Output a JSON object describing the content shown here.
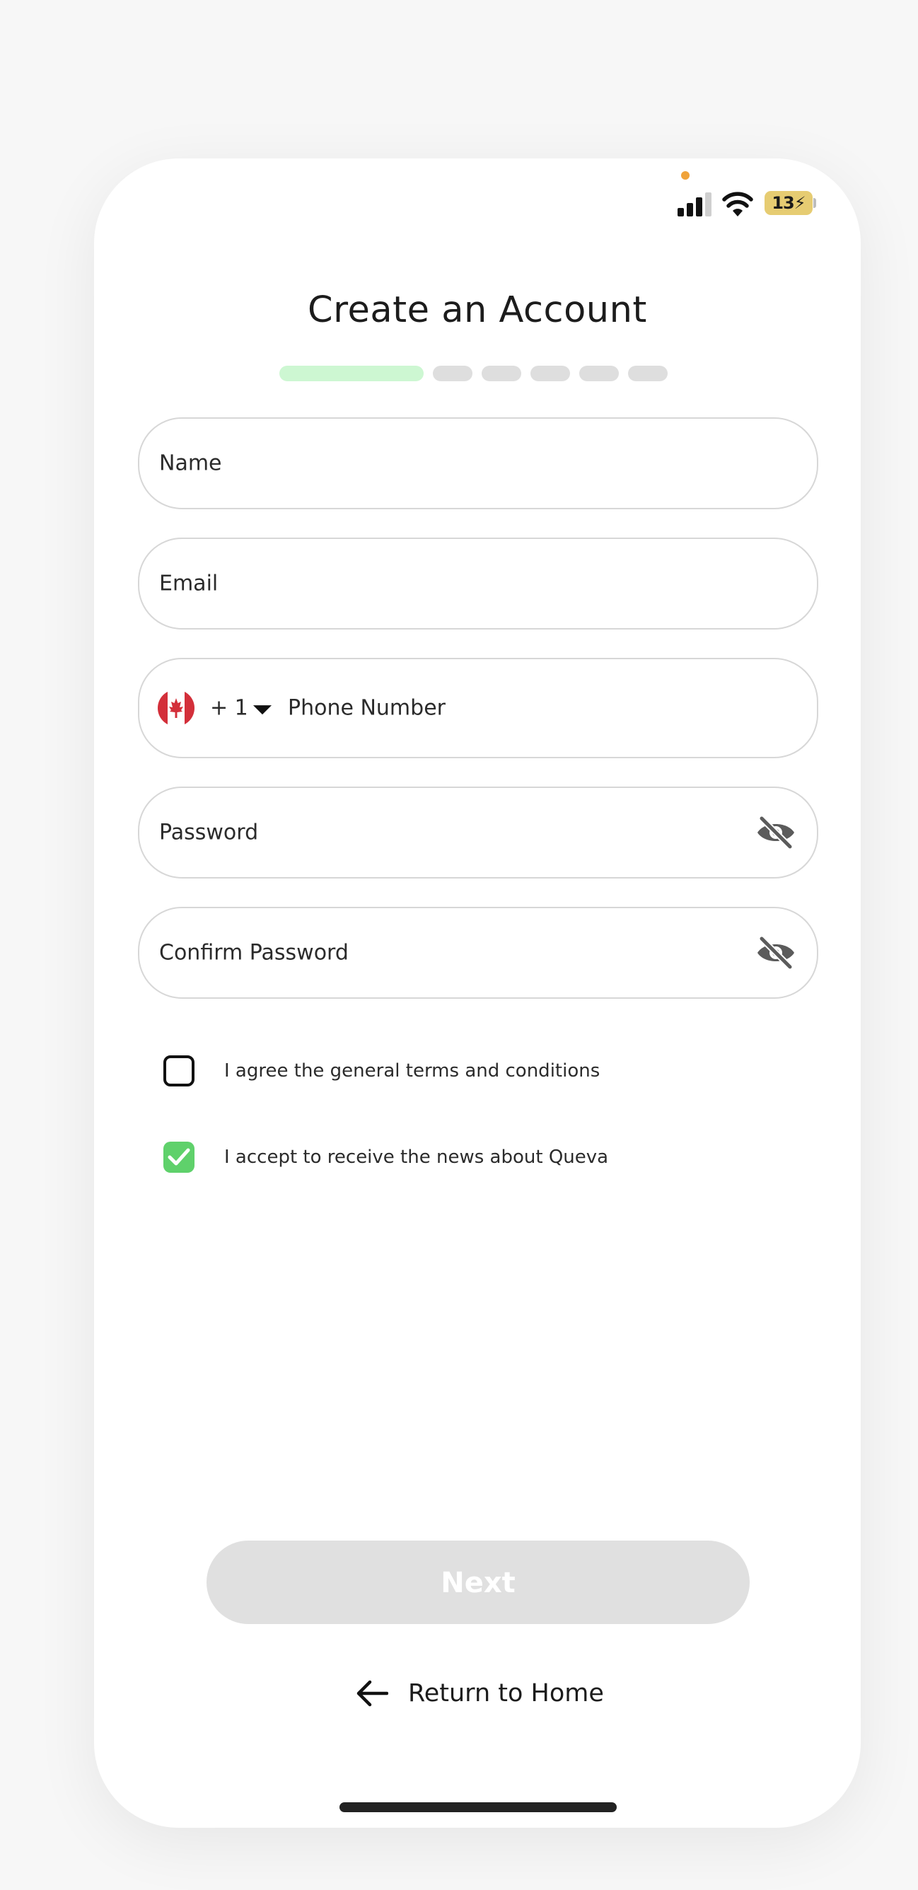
{
  "status_bar": {
    "battery_level": "13",
    "icons": [
      "signal-icon",
      "wifi-icon",
      "battery-charging-icon"
    ]
  },
  "title": "Create an Account",
  "progress": {
    "current_step": 1,
    "total_steps": 6
  },
  "form": {
    "name_placeholder": "Name",
    "email_placeholder": "Email",
    "phone": {
      "country_flag": "canada-flag-icon",
      "country_code": "+ 1",
      "placeholder": "Phone Number"
    },
    "password_placeholder": "Password",
    "confirm_password_placeholder": "Confirm Password"
  },
  "checkboxes": [
    {
      "label": "I agree the general terms and conditions",
      "checked": false
    },
    {
      "label": "I accept to receive the news about Queva",
      "checked": true
    }
  ],
  "actions": {
    "next_label": "Next",
    "return_label": "Return to Home"
  },
  "colors": {
    "progress_active": "#cdf7d2",
    "progress_inactive": "#dedede",
    "checkbox_checked": "#5fd16b",
    "next_disabled_bg": "#e0e0e0",
    "status_dot": "#f0a33a",
    "battery": "#e6cc72"
  }
}
